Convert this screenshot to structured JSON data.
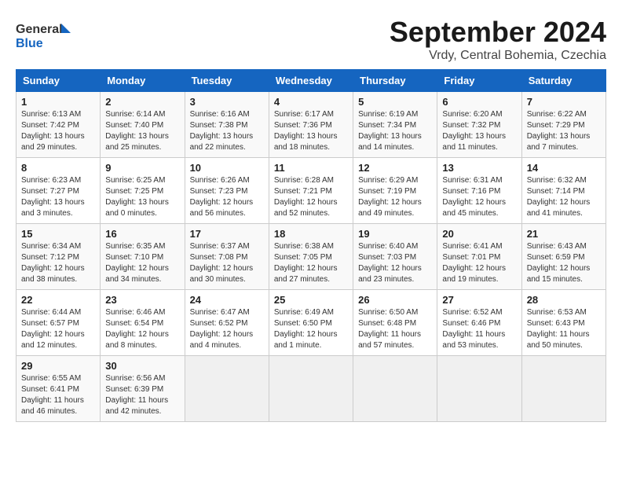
{
  "header": {
    "logo_general": "General",
    "logo_blue": "Blue",
    "month_title": "September 2024",
    "subtitle": "Vrdy, Central Bohemia, Czechia"
  },
  "weekdays": [
    "Sunday",
    "Monday",
    "Tuesday",
    "Wednesday",
    "Thursday",
    "Friday",
    "Saturday"
  ],
  "weeks": [
    [
      {
        "day": "1",
        "sunrise": "6:13 AM",
        "sunset": "7:42 PM",
        "daylight": "13 hours and 29 minutes."
      },
      {
        "day": "2",
        "sunrise": "6:14 AM",
        "sunset": "7:40 PM",
        "daylight": "13 hours and 25 minutes."
      },
      {
        "day": "3",
        "sunrise": "6:16 AM",
        "sunset": "7:38 PM",
        "daylight": "13 hours and 22 minutes."
      },
      {
        "day": "4",
        "sunrise": "6:17 AM",
        "sunset": "7:36 PM",
        "daylight": "13 hours and 18 minutes."
      },
      {
        "day": "5",
        "sunrise": "6:19 AM",
        "sunset": "7:34 PM",
        "daylight": "13 hours and 14 minutes."
      },
      {
        "day": "6",
        "sunrise": "6:20 AM",
        "sunset": "7:32 PM",
        "daylight": "13 hours and 11 minutes."
      },
      {
        "day": "7",
        "sunrise": "6:22 AM",
        "sunset": "7:29 PM",
        "daylight": "13 hours and 7 minutes."
      }
    ],
    [
      {
        "day": "8",
        "sunrise": "6:23 AM",
        "sunset": "7:27 PM",
        "daylight": "13 hours and 3 minutes."
      },
      {
        "day": "9",
        "sunrise": "6:25 AM",
        "sunset": "7:25 PM",
        "daylight": "13 hours and 0 minutes."
      },
      {
        "day": "10",
        "sunrise": "6:26 AM",
        "sunset": "7:23 PM",
        "daylight": "12 hours and 56 minutes."
      },
      {
        "day": "11",
        "sunrise": "6:28 AM",
        "sunset": "7:21 PM",
        "daylight": "12 hours and 52 minutes."
      },
      {
        "day": "12",
        "sunrise": "6:29 AM",
        "sunset": "7:19 PM",
        "daylight": "12 hours and 49 minutes."
      },
      {
        "day": "13",
        "sunrise": "6:31 AM",
        "sunset": "7:16 PM",
        "daylight": "12 hours and 45 minutes."
      },
      {
        "day": "14",
        "sunrise": "6:32 AM",
        "sunset": "7:14 PM",
        "daylight": "12 hours and 41 minutes."
      }
    ],
    [
      {
        "day": "15",
        "sunrise": "6:34 AM",
        "sunset": "7:12 PM",
        "daylight": "12 hours and 38 minutes."
      },
      {
        "day": "16",
        "sunrise": "6:35 AM",
        "sunset": "7:10 PM",
        "daylight": "12 hours and 34 minutes."
      },
      {
        "day": "17",
        "sunrise": "6:37 AM",
        "sunset": "7:08 PM",
        "daylight": "12 hours and 30 minutes."
      },
      {
        "day": "18",
        "sunrise": "6:38 AM",
        "sunset": "7:05 PM",
        "daylight": "12 hours and 27 minutes."
      },
      {
        "day": "19",
        "sunrise": "6:40 AM",
        "sunset": "7:03 PM",
        "daylight": "12 hours and 23 minutes."
      },
      {
        "day": "20",
        "sunrise": "6:41 AM",
        "sunset": "7:01 PM",
        "daylight": "12 hours and 19 minutes."
      },
      {
        "day": "21",
        "sunrise": "6:43 AM",
        "sunset": "6:59 PM",
        "daylight": "12 hours and 15 minutes."
      }
    ],
    [
      {
        "day": "22",
        "sunrise": "6:44 AM",
        "sunset": "6:57 PM",
        "daylight": "12 hours and 12 minutes."
      },
      {
        "day": "23",
        "sunrise": "6:46 AM",
        "sunset": "6:54 PM",
        "daylight": "12 hours and 8 minutes."
      },
      {
        "day": "24",
        "sunrise": "6:47 AM",
        "sunset": "6:52 PM",
        "daylight": "12 hours and 4 minutes."
      },
      {
        "day": "25",
        "sunrise": "6:49 AM",
        "sunset": "6:50 PM",
        "daylight": "12 hours and 1 minute."
      },
      {
        "day": "26",
        "sunrise": "6:50 AM",
        "sunset": "6:48 PM",
        "daylight": "11 hours and 57 minutes."
      },
      {
        "day": "27",
        "sunrise": "6:52 AM",
        "sunset": "6:46 PM",
        "daylight": "11 hours and 53 minutes."
      },
      {
        "day": "28",
        "sunrise": "6:53 AM",
        "sunset": "6:43 PM",
        "daylight": "11 hours and 50 minutes."
      }
    ],
    [
      {
        "day": "29",
        "sunrise": "6:55 AM",
        "sunset": "6:41 PM",
        "daylight": "11 hours and 46 minutes."
      },
      {
        "day": "30",
        "sunrise": "6:56 AM",
        "sunset": "6:39 PM",
        "daylight": "11 hours and 42 minutes."
      },
      null,
      null,
      null,
      null,
      null
    ]
  ]
}
